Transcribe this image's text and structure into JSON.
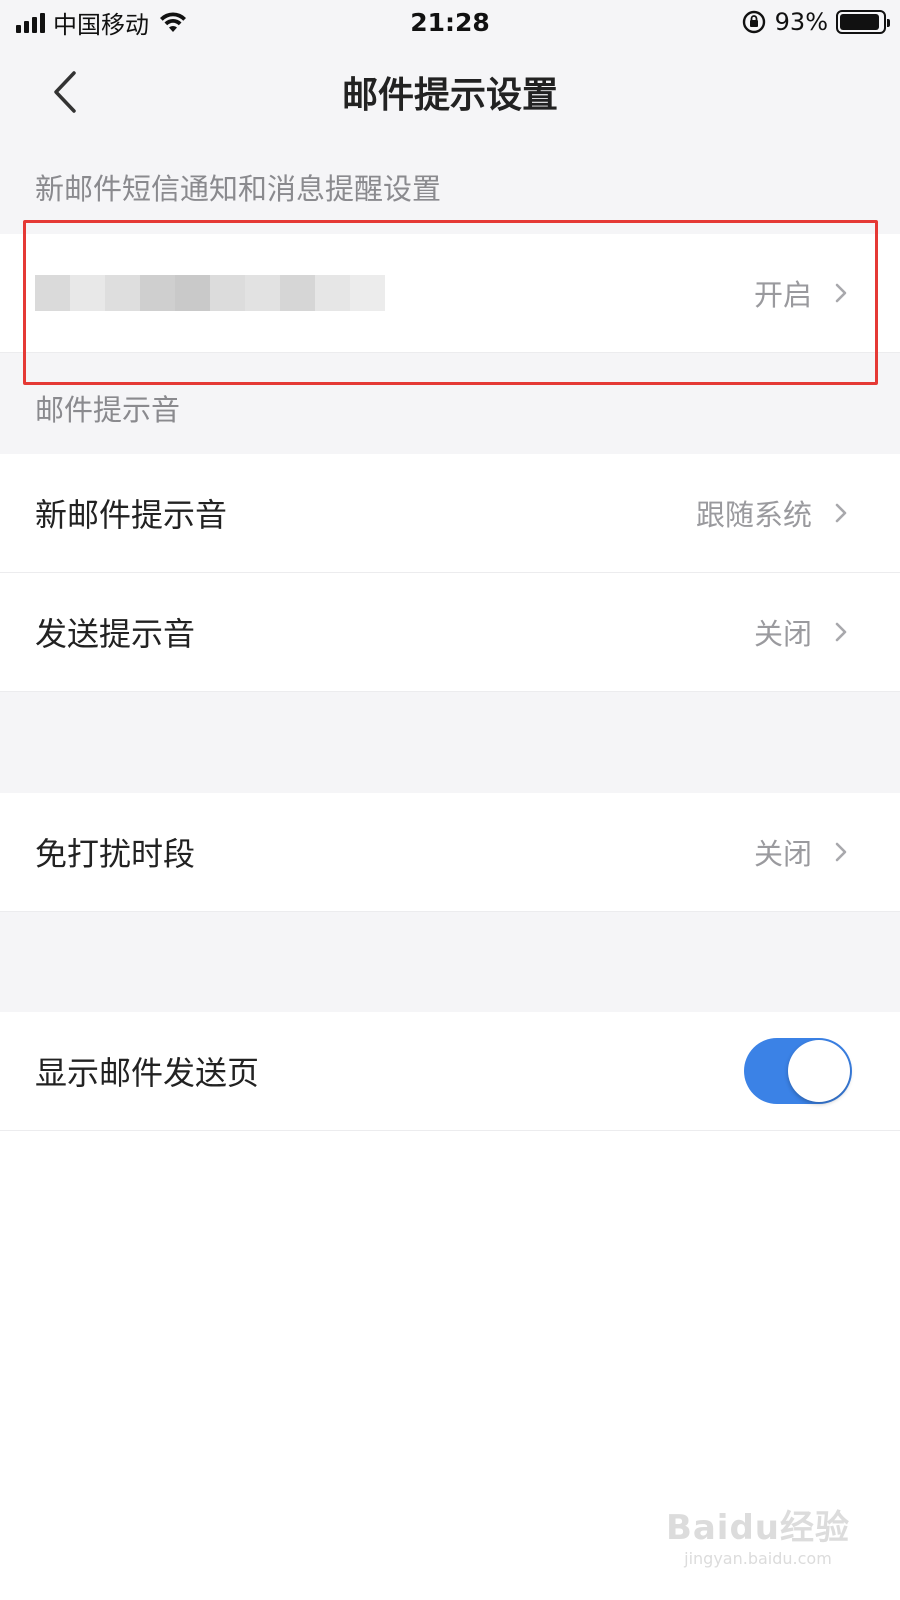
{
  "status": {
    "carrier": "中国移动",
    "time": "21:28",
    "battery": "93%",
    "battery_level": 0.93
  },
  "nav": {
    "title": "邮件提示设置",
    "back_icon": "chevron-left-icon"
  },
  "sections": {
    "sms_label": "新邮件短信通知和消息提醒设置",
    "sound_label": "邮件提示音"
  },
  "rows": {
    "sms_value": "开启",
    "new_mail_sound_label": "新邮件提示音",
    "new_mail_sound_value": "跟随系统",
    "send_sound_label": "发送提示音",
    "send_sound_value": "关闭",
    "dnd_label": "免打扰时段",
    "dnd_value": "关闭",
    "show_send_page_label": "显示邮件发送页",
    "show_send_page_on": true
  },
  "colors": {
    "accent": "#3b82e6",
    "highlight": "#e53935"
  },
  "watermark": {
    "logo": "Baidu经验",
    "url": "jingyan.baidu.com"
  }
}
